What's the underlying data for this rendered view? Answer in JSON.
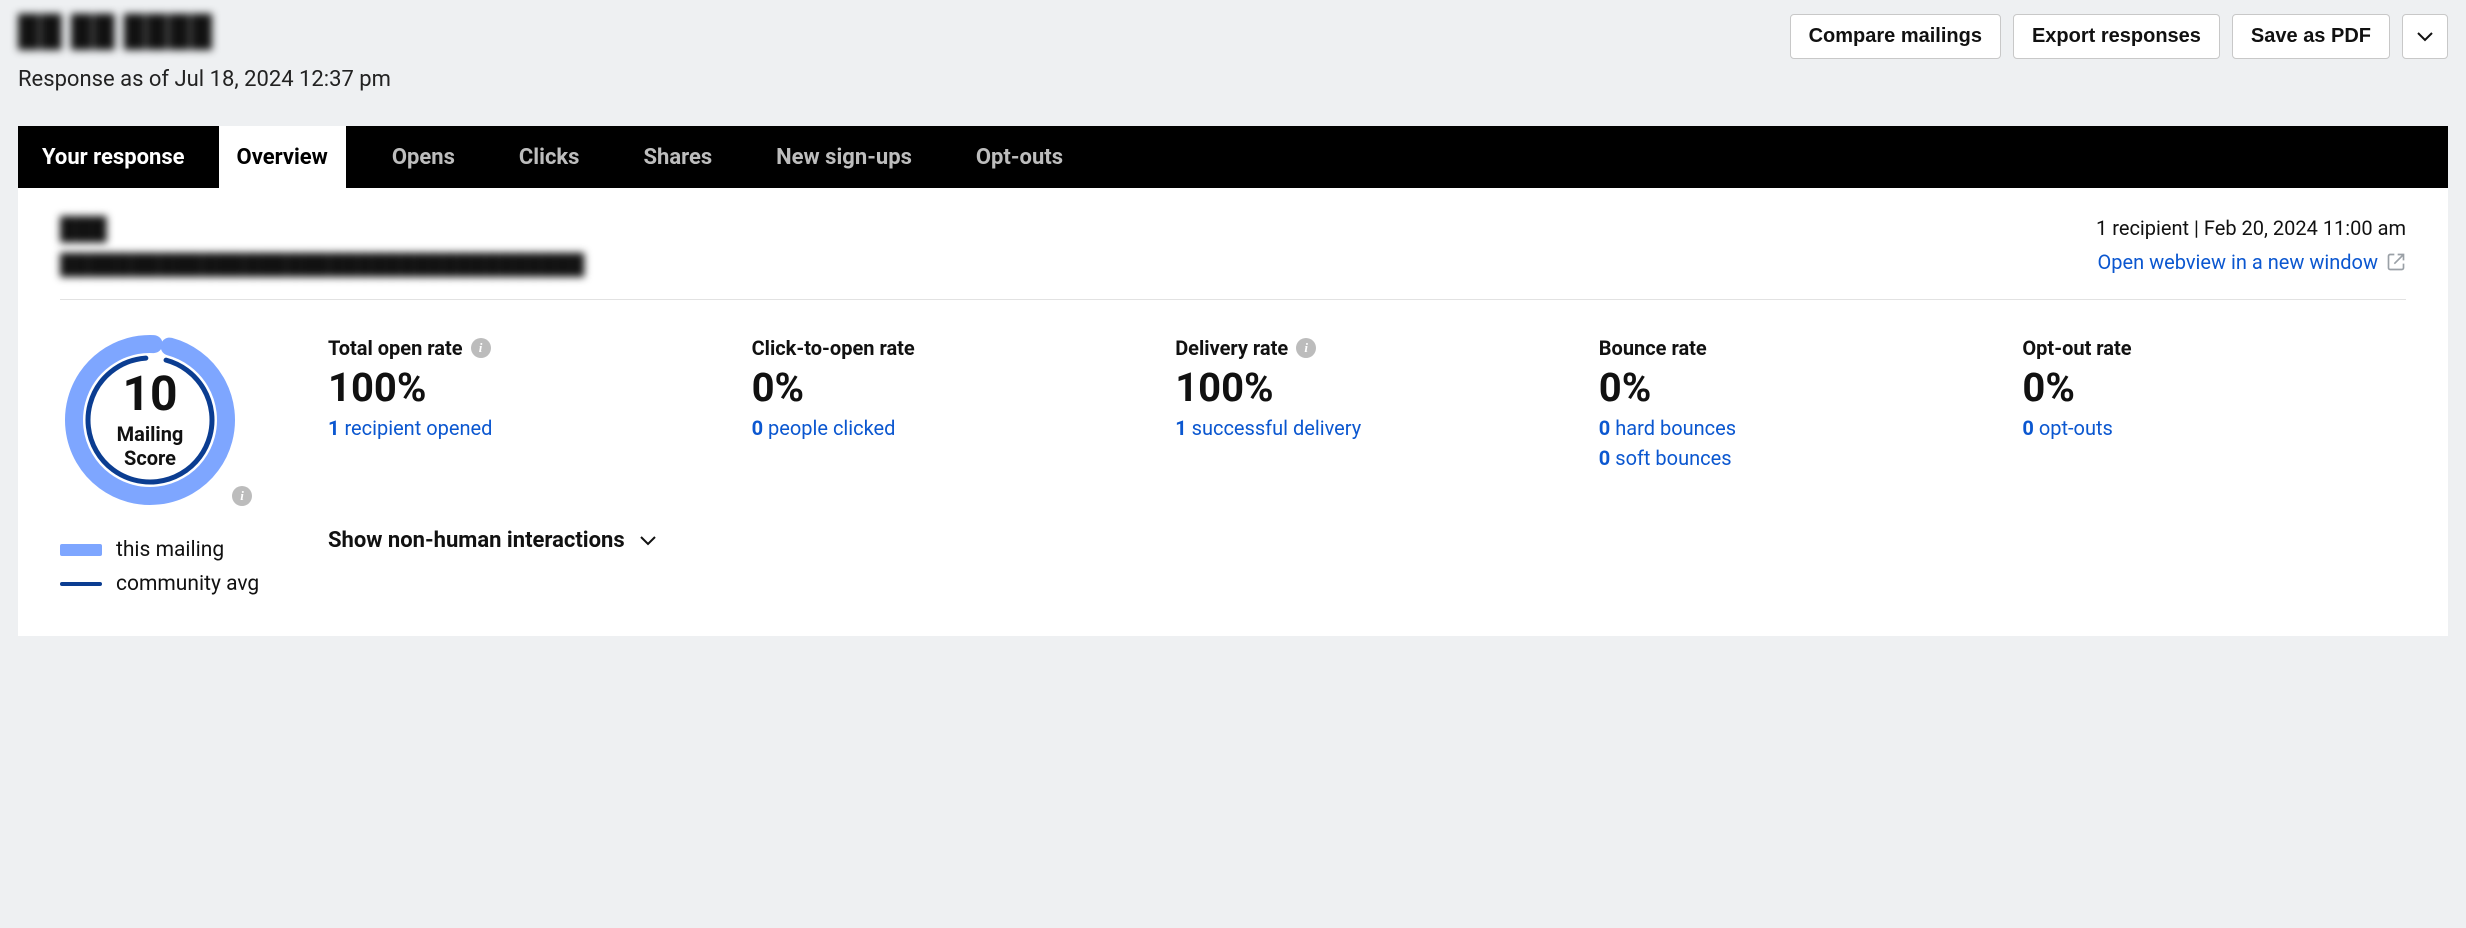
{
  "header": {
    "title": "██ ██ ████",
    "response_as_of": "Response as of Jul 18, 2024 12:37 pm",
    "actions": {
      "compare": "Compare mailings",
      "export": "Export responses",
      "save_pdf": "Save as PDF"
    }
  },
  "tabs": {
    "static_label": "Your response",
    "items": [
      {
        "label": "Overview",
        "active": true
      },
      {
        "label": "Opens",
        "active": false
      },
      {
        "label": "Clicks",
        "active": false
      },
      {
        "label": "Shares",
        "active": false
      },
      {
        "label": "New sign-ups",
        "active": false
      },
      {
        "label": "Opt-outs",
        "active": false
      }
    ]
  },
  "mailing": {
    "subject": "███",
    "from_line": "█████████████████████████████████████",
    "recipients_line": "1 recipient | Feb 20, 2024 11:00 am",
    "webview_label": "Open webview in a new window"
  },
  "score": {
    "value": "10",
    "label": "Mailing\nScore",
    "legend": {
      "this_mailing": "this mailing",
      "community_avg": "community avg"
    }
  },
  "metrics": {
    "total_open_rate": {
      "title": "Total open rate",
      "value": "100%",
      "detail_num": "1",
      "detail_text": " recipient opened",
      "has_info": true
    },
    "click_to_open": {
      "title": "Click-to-open rate",
      "value": "0%",
      "detail_num": "0",
      "detail_text": " people clicked",
      "has_info": false
    },
    "delivery_rate": {
      "title": "Delivery rate",
      "value": "100%",
      "detail_num": "1",
      "detail_text": " successful delivery",
      "has_info": true
    },
    "bounce_rate": {
      "title": "Bounce rate",
      "value": "0%",
      "hard_num": "0",
      "hard_text": " hard bounces",
      "soft_num": "0",
      "soft_text": " soft bounces",
      "has_info": false
    },
    "optout_rate": {
      "title": "Opt-out rate",
      "value": "0%",
      "detail_num": "0",
      "detail_text": " opt-outs",
      "has_info": false
    }
  },
  "show_nonhuman": "Show non-human interactions",
  "chart_data": {
    "type": "pie",
    "title": "Mailing Score",
    "series": [
      {
        "name": "this mailing",
        "value": 10,
        "max": 10,
        "color": "#7ea6ff"
      },
      {
        "name": "community avg",
        "value": 9.5,
        "max": 10,
        "color": "#0b3d91"
      }
    ]
  }
}
